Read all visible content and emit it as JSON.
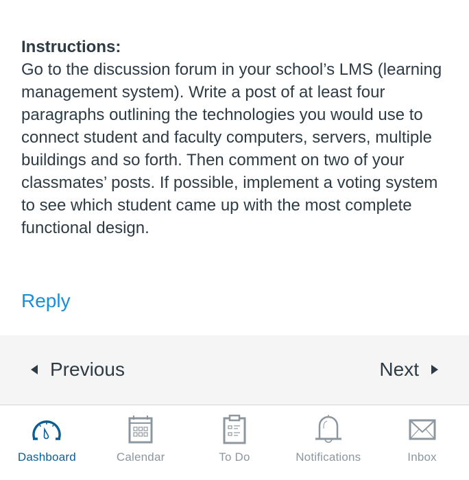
{
  "content": {
    "heading": "Instructions:",
    "body": "Go to the discussion forum in your school’s LMS (learning management system). Write a post of at least four paragraphs outlining the technologies you would use to connect student and faculty computers, servers, multiple buildings and so forth. Then comment on two of your classmates’ posts. If possible, implement a voting system to see which student came up with the most complete functional design."
  },
  "reply_label": "Reply",
  "pager": {
    "previous_label": "Previous",
    "next_label": "Next"
  },
  "tabbar": {
    "active_color": "#0b5e94",
    "inactive_color": "#8b969e",
    "items": [
      {
        "label": "Dashboard",
        "icon": "dashboard-gauge-icon",
        "active": true
      },
      {
        "label": "Calendar",
        "icon": "calendar-icon",
        "active": false
      },
      {
        "label": "To Do",
        "icon": "clipboard-todo-icon",
        "active": false
      },
      {
        "label": "Notifications",
        "icon": "bell-icon",
        "active": false
      },
      {
        "label": "Inbox",
        "icon": "envelope-icon",
        "active": false
      }
    ]
  }
}
